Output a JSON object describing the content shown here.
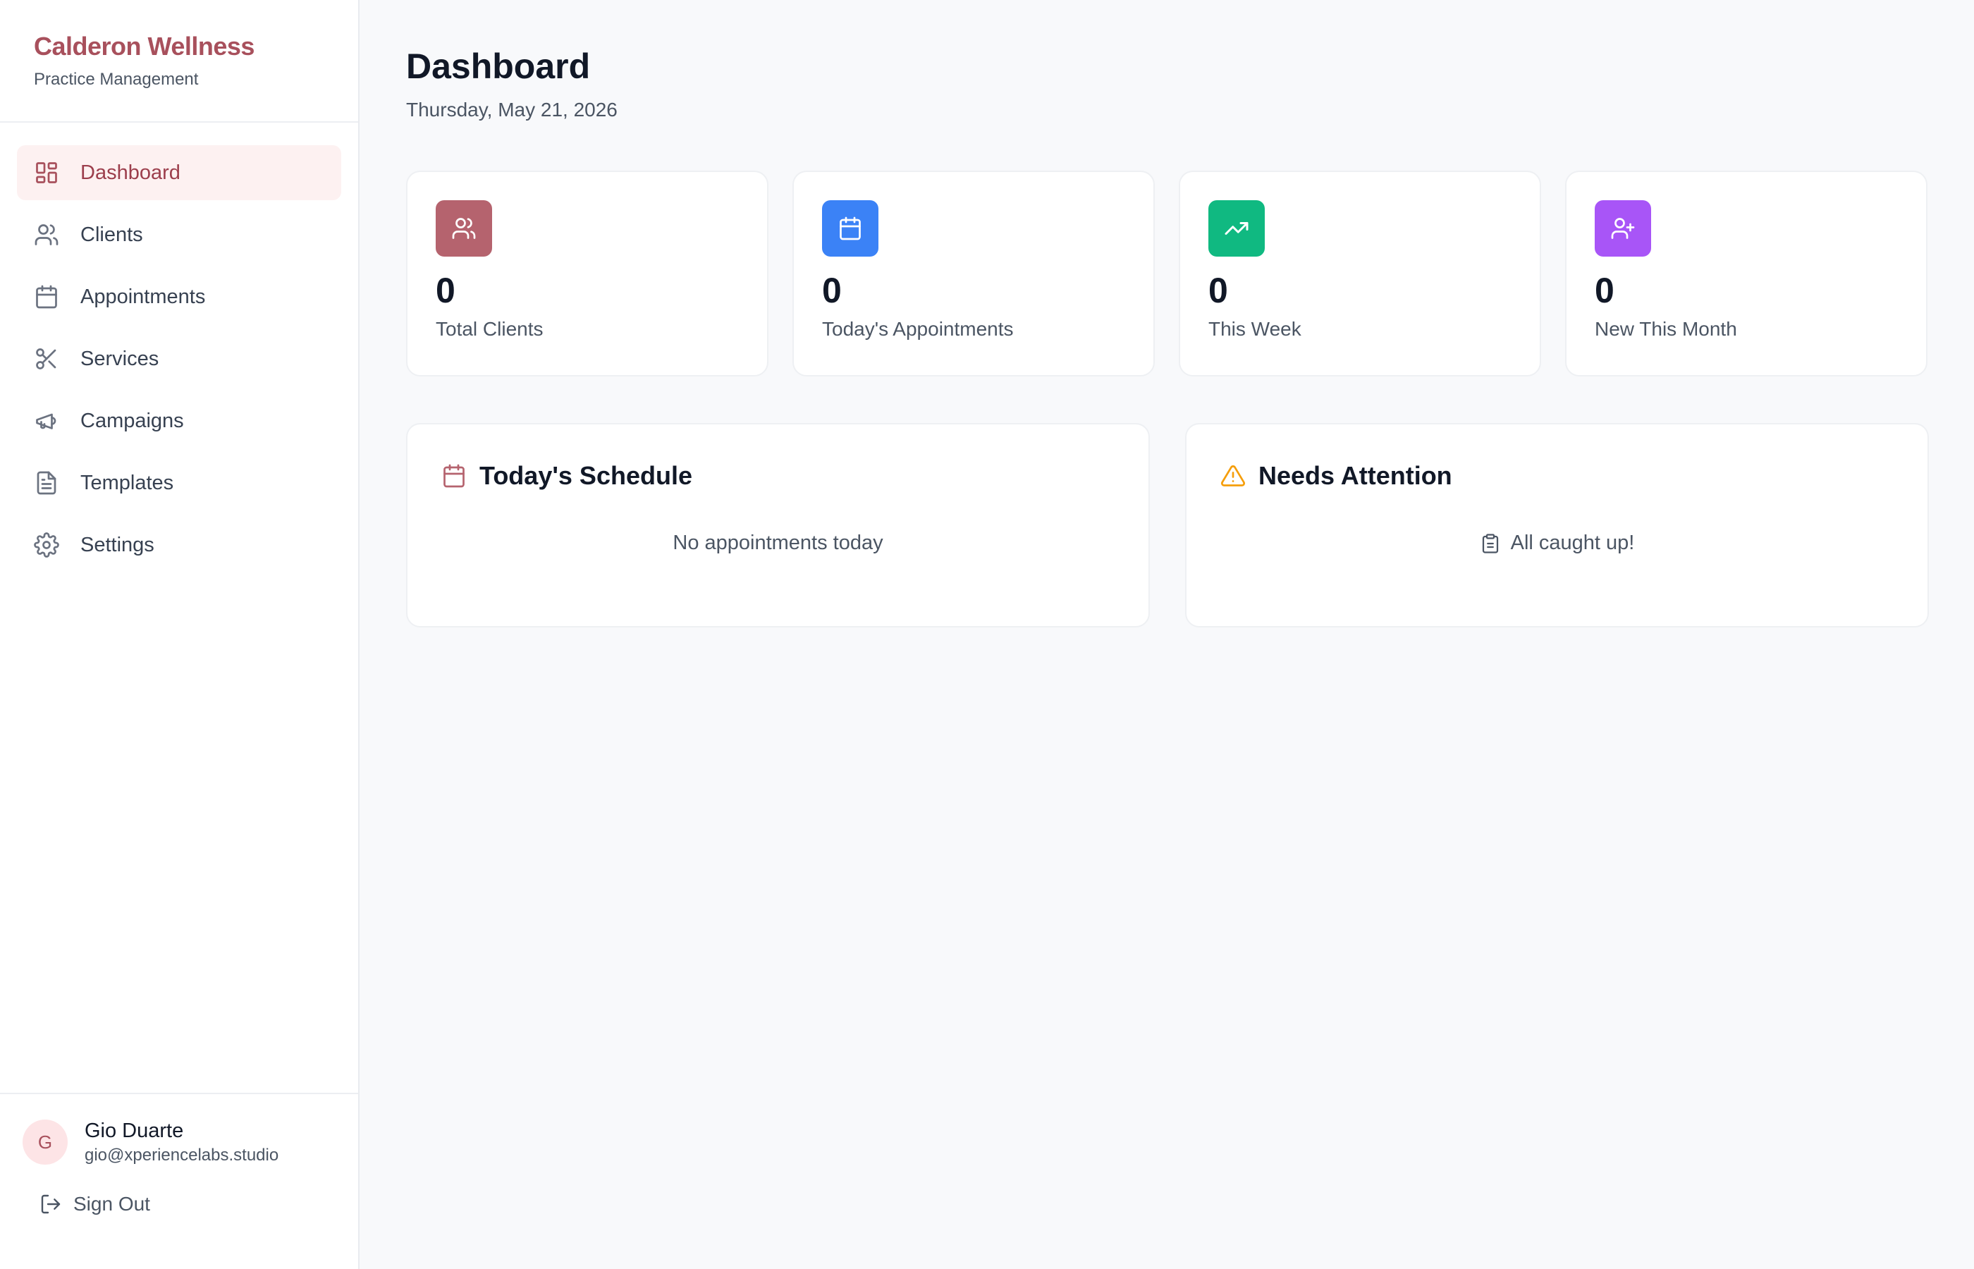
{
  "brand": {
    "title": "Calderon Wellness",
    "subtitle": "Practice Management"
  },
  "nav": [
    {
      "label": "Dashboard",
      "icon": "dashboard-grid-icon",
      "active": true
    },
    {
      "label": "Clients",
      "icon": "users-icon",
      "active": false
    },
    {
      "label": "Appointments",
      "icon": "calendar-icon",
      "active": false
    },
    {
      "label": "Services",
      "icon": "scissors-icon",
      "active": false
    },
    {
      "label": "Campaigns",
      "icon": "megaphone-icon",
      "active": false
    },
    {
      "label": "Templates",
      "icon": "document-icon",
      "active": false
    },
    {
      "label": "Settings",
      "icon": "gear-icon",
      "active": false
    }
  ],
  "user": {
    "initial": "G",
    "name": "Gio Duarte",
    "email": "gio@xperiencelabs.studio",
    "signout_label": "Sign Out"
  },
  "page": {
    "title": "Dashboard",
    "date": "Thursday, May 21, 2026"
  },
  "stats": [
    {
      "value": "0",
      "label": "Total Clients",
      "icon": "users-icon",
      "color": "#b5636e"
    },
    {
      "value": "0",
      "label": "Today's Appointments",
      "icon": "calendar-icon",
      "color": "#3b82f6"
    },
    {
      "value": "0",
      "label": "This Week",
      "icon": "trending-up-icon",
      "color": "#10b981"
    },
    {
      "value": "0",
      "label": "New This Month",
      "icon": "user-plus-icon",
      "color": "#a855f7"
    }
  ],
  "schedule": {
    "title": "Today's Schedule",
    "empty_text": "No appointments today",
    "icon": "calendar-icon",
    "icon_color": "#b5636e"
  },
  "attention": {
    "title": "Needs Attention",
    "empty_text": "All caught up!",
    "icon": "warning-triangle-icon",
    "icon_color": "#f59e0b"
  },
  "colors": {
    "accent": "#a8505c",
    "active_bg": "#fdf1f1"
  }
}
